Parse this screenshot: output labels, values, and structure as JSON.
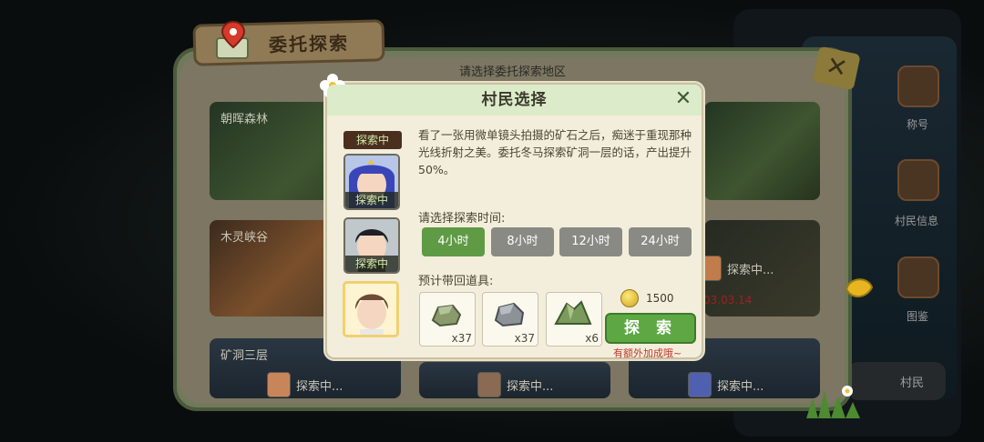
{
  "header": {
    "title": "委托探索",
    "region_prompt": "请选择委托探索地区"
  },
  "regions": [
    {
      "name": "朝晖森林"
    },
    {
      "name": "木灵峡谷"
    },
    {
      "name": "矿洞三层"
    }
  ],
  "region_status": [
    {
      "text": "探索中..."
    },
    {
      "text": "探索中..."
    },
    {
      "text": "探索中..."
    },
    {
      "text": "探索中..."
    }
  ],
  "right_date": "03.03.14",
  "side_menu": {
    "title_label": "称号",
    "villager_info": "村民信息",
    "gallery": "图鉴",
    "villager": "村民"
  },
  "dialog": {
    "title": "村民选择",
    "close": "✕",
    "description": "看了一张用微单镜头拍摄的矿石之后，痴迷于重现那种光线折射之美。委托冬马探索矿洞一层的话，产出提升50%。",
    "time_label": "请选择探索时间:",
    "times": [
      "4小时",
      "8小时",
      "12小时",
      "24小时"
    ],
    "selected_time_index": 0,
    "items_label": "预计带回道具:",
    "items": [
      {
        "icon": "green-ore-icon",
        "count": "x37"
      },
      {
        "icon": "grey-stone-icon",
        "count": "x37"
      },
      {
        "icon": "green-crystal-icon",
        "count": "x6"
      }
    ],
    "coin": "1500",
    "explore_button": "探 索",
    "bonus_note": "有额外加成哦~"
  },
  "villagers": {
    "top_tag": "探索中",
    "entries": [
      {
        "tag": "探索中"
      },
      {
        "tag": "探索中"
      },
      {
        "tag": ""
      }
    ]
  },
  "colors": {
    "active_green": "#5f9a45",
    "dialog_bg": "#f3eedc",
    "header_green": "#dcebc9",
    "bonus_red": "#c0362c"
  }
}
